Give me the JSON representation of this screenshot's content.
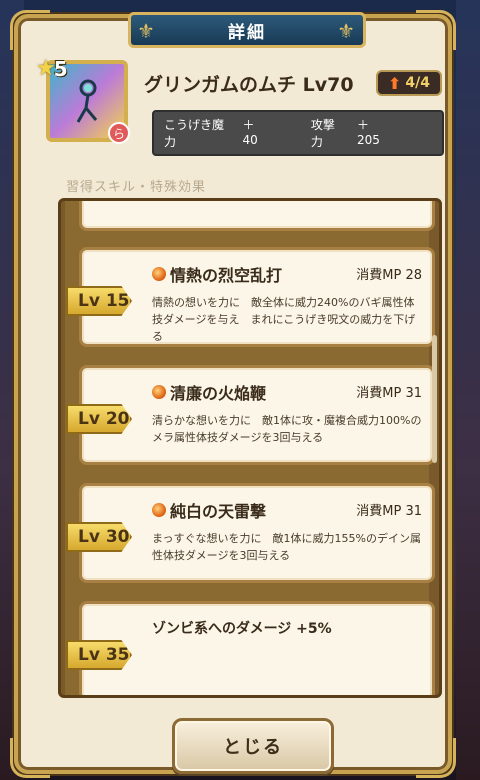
{
  "window": {
    "title": "詳細"
  },
  "weapon": {
    "rarity_stars": "5",
    "name": "グリンガムのムチ Lv70",
    "evolution": "4/4",
    "stats": [
      {
        "label": "こうげき魔力",
        "value": "＋40"
      },
      {
        "label": "攻撃力",
        "value": "＋205"
      }
    ]
  },
  "section": {
    "label": "習得スキル・特殊効果"
  },
  "skills": [
    {
      "level": "Lv 15",
      "name": "情熱の烈空乱打",
      "mp": "消費MP 28",
      "desc": "情熱の想いを力に　敵全体に威力240%のバギ属性体技ダメージを与え　まれにこうげき呪文の威力を下げる",
      "icon": "flame-orb-icon"
    },
    {
      "level": "Lv 20",
      "name": "清廉の火焔鞭",
      "mp": "消費MP 31",
      "desc": "清らかな想いを力に　敵1体に攻・魔複合威力100%のメラ属性体技ダメージを3回与える",
      "icon": "flame-orb-icon"
    },
    {
      "level": "Lv 30",
      "name": "純白の天雷撃",
      "mp": "消費MP 31",
      "desc": "まっすぐな想いを力に　敵1体に威力155%のデイン属性体技ダメージを3回与える",
      "icon": "flame-orb-icon"
    },
    {
      "level": "Lv 35",
      "name": "ゾンビ系へのダメージ +5%",
      "mp": "",
      "desc": ""
    }
  ],
  "buttons": {
    "close": "とじる"
  },
  "colors": {
    "panel": "#f3ead6",
    "gold": "#c9a450",
    "stats_bg": "#4a4a4a",
    "lv_tag": "#d6a82e"
  }
}
